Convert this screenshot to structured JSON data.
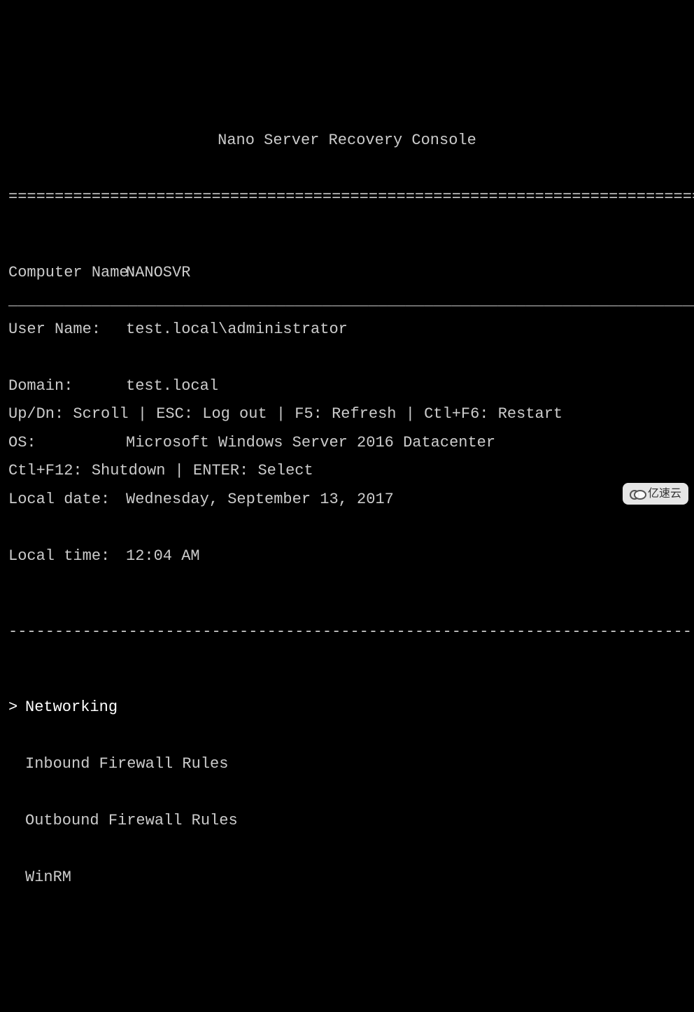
{
  "title": "Nano Server Recovery Console",
  "separator_double": "================================================================================",
  "separator_dash": "--------------------------------------------------------------------------------",
  "separator_under": "________________________________________________________________________________",
  "info": {
    "computer_name_label": "Computer Name: ",
    "computer_name_value": "NANOSVR",
    "user_name_label": "User Name:     ",
    "user_name_value": "test.local\\administrator",
    "domain_label": "Domain:        ",
    "domain_value": "test.local",
    "os_label": "OS:            ",
    "os_value": "Microsoft Windows Server 2016 Datacenter",
    "local_date_label": "Local date:    ",
    "local_date_value": "Wednesday, September 13, 2017",
    "local_time_label": "Local time:    ",
    "local_time_value": "12:04 AM"
  },
  "menu": {
    "items": [
      {
        "label": "Networking",
        "selected": true
      },
      {
        "label": "Inbound Firewall Rules",
        "selected": false
      },
      {
        "label": "Outbound Firewall Rules",
        "selected": false
      },
      {
        "label": "WinRM",
        "selected": false
      }
    ],
    "cursor": "> ",
    "nocursor": "  "
  },
  "footer": {
    "line1": "Up/Dn: Scroll | ESC: Log out | F5: Refresh | Ctl+F6: Restart",
    "line2": "Ctl+F12: Shutdown | ENTER: Select"
  },
  "watermark": "亿速云"
}
